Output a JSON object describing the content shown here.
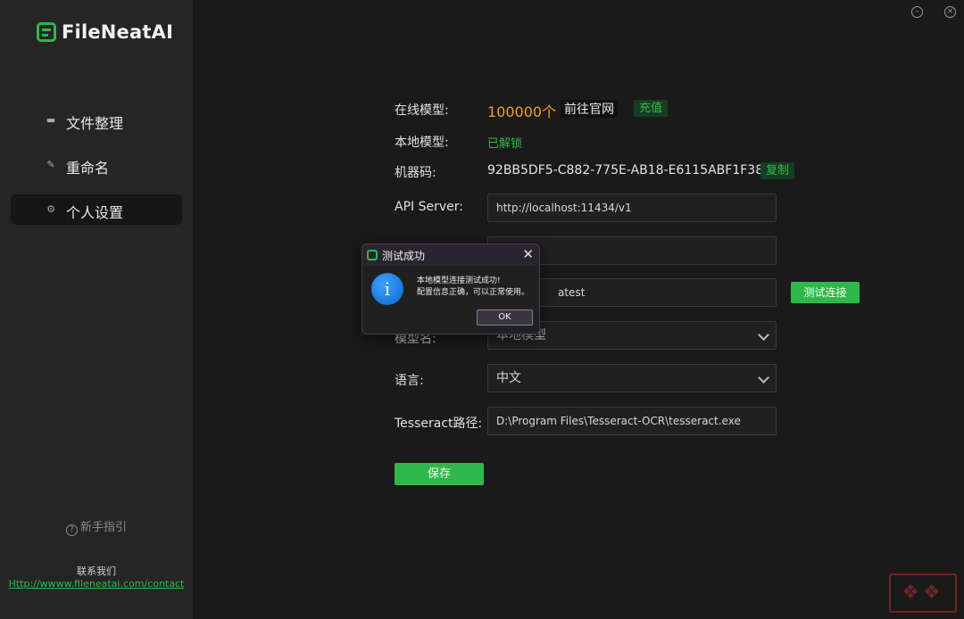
{
  "app": {
    "logo_text": "FileNeatAI"
  },
  "sidebar": {
    "items": [
      {
        "label": "文件整理",
        "icon": "folder-icon"
      },
      {
        "label": "重命名",
        "icon": "edit-icon"
      },
      {
        "label": "个人设置",
        "icon": "gear-icon"
      }
    ],
    "active_index": 2,
    "help_label": "新手指引",
    "contact_label": "联系我们",
    "contact_link": "Http://wwww.fileneatai.com/contact"
  },
  "settings": {
    "online_model": {
      "label": "在线模型:",
      "count": "100000个",
      "official_site": "前往官网",
      "recharge": "充值"
    },
    "local_model": {
      "label": "本地模型:",
      "status": "已解锁"
    },
    "machine_code": {
      "label": "机器码:",
      "value": "92BB5DF5-C882-775E-AB18-E6115ABF1F38",
      "copy": "复制"
    },
    "api_server": {
      "label": "API Server:",
      "value": "http://localhost:11434/v1"
    },
    "model_field": {
      "value_partial": "atest"
    },
    "test_button": "测试连接",
    "model_name": {
      "label_partial": "模型名:",
      "value": "本地模型"
    },
    "language": {
      "label": "语言:",
      "value": "中文"
    },
    "tesseract": {
      "label": "Tesseract路径:",
      "value": "D:\\Program Files\\Tesseract-OCR\\tesseract.exe"
    },
    "save_button": "保存"
  },
  "dialog": {
    "title": "测试成功",
    "line1": "本地模型连接测试成功!",
    "line2": "配置信息正确，可以正常使用。",
    "ok": "OK",
    "icon": "info-icon"
  },
  "colors": {
    "accent": "#2fb84a",
    "orange": "#f0a020",
    "bg": "#1a1a1a",
    "sidebar": "#252525"
  }
}
